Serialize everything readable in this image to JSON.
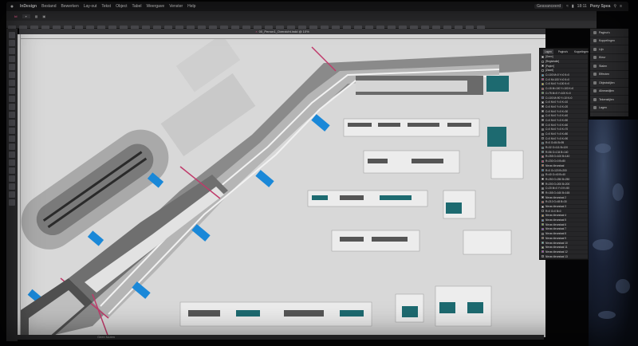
{
  "menubar": {
    "apple": "",
    "items": [
      "InDesign",
      "Bestand",
      "Bewerken",
      "Lay-out",
      "Tekst",
      "Object",
      "Tabel",
      "Weergave",
      "Venster",
      "Help"
    ],
    "clock": "18:11",
    "user": "Pony Spea",
    "workspace": "Geavanceerd"
  },
  "app": {
    "doc_tab": "00_Perron1_Overzicht.indd @ 10%",
    "status": "Geen fouten"
  },
  "layers_panel": {
    "tabs": [
      "Lagen",
      "Pagina's",
      "Koppelingen"
    ],
    "rows": [
      {
        "label": "[Geen]",
        "color": "#ffffff"
      },
      {
        "label": "[Registratie]",
        "color": "#111111"
      },
      {
        "label": "[Papier]",
        "color": "#ffffff"
      },
      {
        "label": "[Zwart]",
        "color": "#000000"
      },
      {
        "label": "C=100 M=0 Y=0 K=0",
        "color": "#00aeef"
      },
      {
        "label": "C=0 M=100 Y=0 K=0",
        "color": "#ec008c"
      },
      {
        "label": "C=0 M=0 Y=100 K=0",
        "color": "#fff200"
      },
      {
        "label": "C=15 M=100 Y=100 K=0",
        "color": "#d2232a"
      },
      {
        "label": "C=75 M=5 Y=100 K=0",
        "color": "#3aa935"
      },
      {
        "label": "C=100 M=90 Y=10 K=0",
        "color": "#2e3192"
      },
      {
        "label": "C=0 M=0 Y=0 K=10",
        "color": "#e6e7e8"
      },
      {
        "label": "C=0 M=0 Y=0 K=20",
        "color": "#d1d3d4"
      },
      {
        "label": "C=0 M=0 Y=0 K=30",
        "color": "#bcbec0"
      },
      {
        "label": "C=0 M=0 Y=0 K=40",
        "color": "#a7a9ac"
      },
      {
        "label": "C=0 M=0 Y=0 K=50",
        "color": "#939598"
      },
      {
        "label": "C=0 M=0 Y=0 K=60",
        "color": "#808285"
      },
      {
        "label": "C=0 M=0 Y=0 K=70",
        "color": "#6d6e71"
      },
      {
        "label": "C=0 M=0 Y=0 K=80",
        "color": "#58595b"
      },
      {
        "label": "C=0 M=0 Y=0 K=90",
        "color": "#414042"
      },
      {
        "label": "R=0 G=84 B=95",
        "color": "#00545f"
      },
      {
        "label": "R=32 G=111 B=120",
        "color": "#206f78"
      },
      {
        "label": "R=56 G=134 B=140",
        "color": "#38868c"
      },
      {
        "label": "R=255 G=100 B=140",
        "color": "#ff648c"
      },
      {
        "label": "R=230 G=0 B=80",
        "color": "#e60050"
      },
      {
        "label": "Nieuw kleurstaal",
        "color": "#ea6e1e"
      },
      {
        "label": "R=0 G=120 B=200",
        "color": "#0078c8"
      },
      {
        "label": "R=40 G=40 B=40",
        "color": "#282828"
      },
      {
        "label": "R=250 G=250 B=250",
        "color": "#fafafa"
      },
      {
        "label": "R=200 G=200 B=200",
        "color": "#c8c8c8"
      },
      {
        "label": "C=20 M=0 Y=0 K=50",
        "color": "#7b8b93"
      },
      {
        "label": "R=155 G=160 B=165",
        "color": "#9ba0a5"
      },
      {
        "label": "Nieuw kleurstaal 2",
        "color": "#cccccc"
      },
      {
        "label": "R=210 G=45 B=30",
        "color": "#d22d1e"
      },
      {
        "label": "Nieuw kleurstaal 3",
        "color": "#ffffff"
      },
      {
        "label": "R=0 G=0 B=0",
        "color": "#000000"
      },
      {
        "label": "Nieuw kleurstaal 4",
        "color": "#f5a623"
      },
      {
        "label": "Nieuw kleurstaal 5",
        "color": "#4a90e2"
      },
      {
        "label": "Nieuw kleurstaal 6",
        "color": "#7ed321"
      },
      {
        "label": "Nieuw kleurstaal 7",
        "color": "#9013fe"
      },
      {
        "label": "Nieuw kleurstaal 8",
        "color": "#555555"
      },
      {
        "label": "Nieuw kleurstaal 9",
        "color": "#8b572a"
      },
      {
        "label": "Nieuw kleurstaal 10",
        "color": "#50e3c2"
      },
      {
        "label": "Nieuw kleurstaal 11",
        "color": "#b8e986"
      },
      {
        "label": "Nieuw kleurstaal 12",
        "color": "#bd10e0"
      },
      {
        "label": "Nieuw kleurstaal 13",
        "color": "#4a4a4a"
      }
    ]
  },
  "side_panels": [
    {
      "label": "Pagina's",
      "icon": "pages-icon"
    },
    {
      "label": "Koppelingen",
      "icon": "links-icon"
    },
    {
      "label": "Lijn",
      "icon": "stroke-icon"
    },
    {
      "label": "Kleur",
      "icon": "color-icon"
    },
    {
      "label": "Stalen",
      "icon": "swatches-icon"
    },
    {
      "label": "Effecten",
      "icon": "effects-icon"
    },
    {
      "label": "Objectstijlen",
      "icon": "object-styles-icon"
    },
    {
      "label": "Alineastijlen",
      "icon": "paragraph-styles-icon"
    },
    {
      "label": "Tekenstijlen",
      "icon": "character-styles-icon"
    },
    {
      "label": "Lagen",
      "icon": "layers-icon"
    }
  ],
  "tools": [
    "selection-icon",
    "direct-selection-icon",
    "page-tool-icon",
    "gap-tool-icon",
    "type-icon",
    "line-icon",
    "pen-icon",
    "pencil-icon",
    "rectangle-frame-icon",
    "rectangle-icon",
    "scissors-icon",
    "free-transform-icon",
    "gradient-icon",
    "note-icon",
    "eyedropper-icon",
    "hand-icon",
    "zoom-icon",
    "fill-stroke-icon",
    "swap-icon",
    "default-colors-icon",
    "apply-color-icon",
    "preview-mode-icon"
  ],
  "colors": {
    "accent_pink": "#c03a6a",
    "blue_marker": "#1a88d8",
    "teal_glass": "#1d6a70",
    "ground_dark": "#555555"
  }
}
